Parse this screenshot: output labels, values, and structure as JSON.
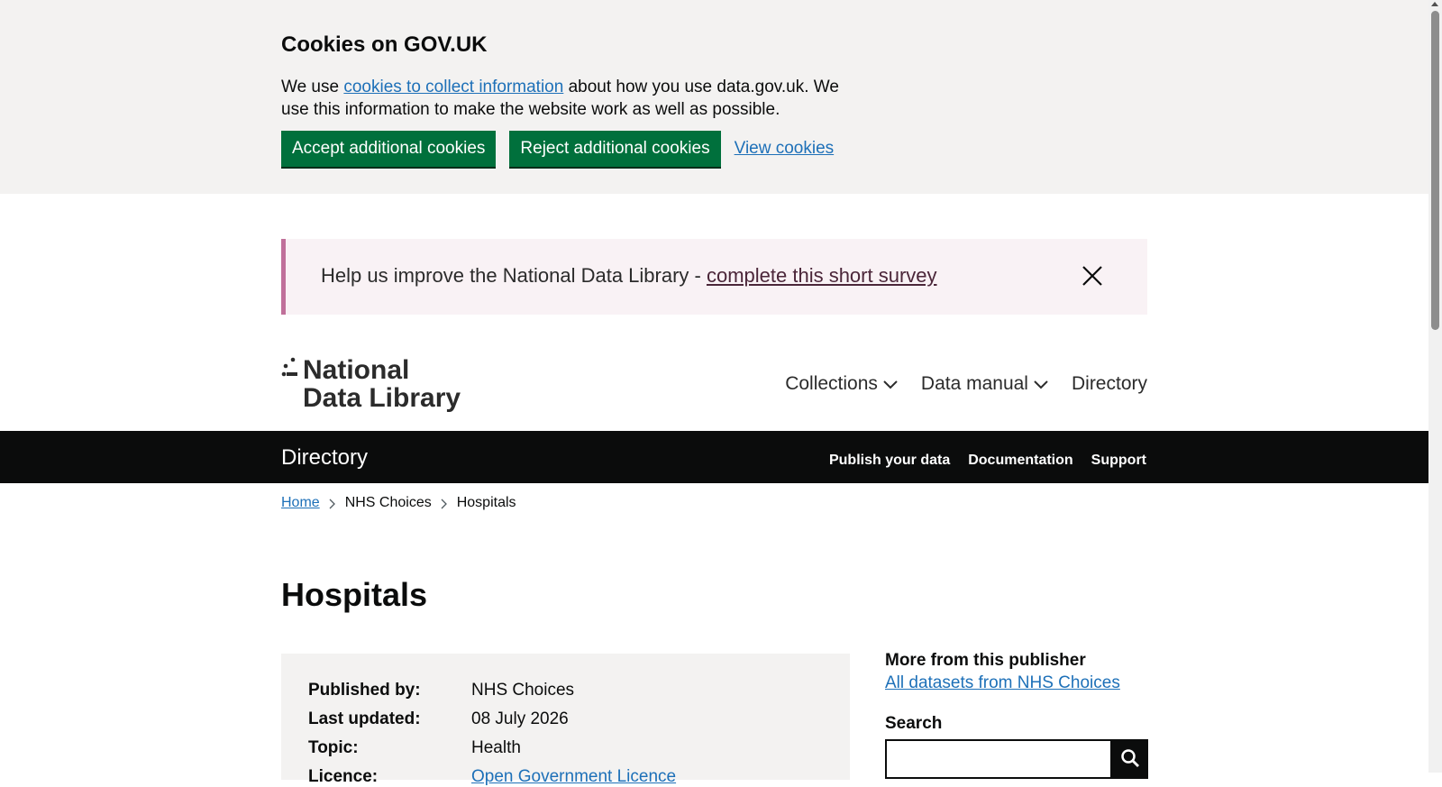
{
  "cookie_banner": {
    "title": "Cookies on GOV.UK",
    "text_before": "We use ",
    "link_text": "cookies to collect information",
    "text_after": " about how you use data.gov.uk. We use this information to make the website work as well as possible.",
    "accept_label": "Accept additional cookies",
    "reject_label": "Reject additional cookies",
    "view_label": "View cookies"
  },
  "survey": {
    "text": "Help us improve the National Data Library - ",
    "link_text": "complete this short survey"
  },
  "logo": {
    "line1": "National",
    "line2": "Data Library"
  },
  "main_nav": {
    "items": [
      {
        "label": "Collections",
        "has_dropdown": true
      },
      {
        "label": "Data manual",
        "has_dropdown": true
      },
      {
        "label": "Directory",
        "has_dropdown": false
      }
    ]
  },
  "directory_bar": {
    "title": "Directory",
    "links": [
      "Publish your data",
      "Documentation",
      "Support"
    ]
  },
  "breadcrumb": {
    "items": [
      "Home",
      "NHS Choices",
      "Hospitals"
    ]
  },
  "page": {
    "title": "Hospitals"
  },
  "meta": {
    "rows": [
      {
        "label": "Published by:",
        "value": "NHS Choices"
      },
      {
        "label": "Last updated:",
        "value": "08 July 2026"
      },
      {
        "label": "Topic:",
        "value": "Health"
      },
      {
        "label": "Licence:",
        "value": "Open Government Licence"
      }
    ]
  },
  "sidebar": {
    "more_heading": "More from this publisher",
    "publisher_link": "All datasets from NHS Choices",
    "search_label": "Search",
    "search_value": ""
  },
  "colors": {
    "button_green": "#00703c",
    "link_blue": "#1d70b8",
    "survey_border": "#c0709a",
    "banner_grey": "#f3f2f1",
    "bar_black": "#0b0c0c"
  }
}
